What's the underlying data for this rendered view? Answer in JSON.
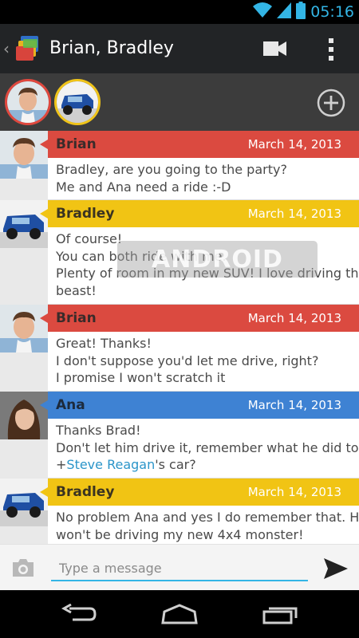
{
  "status_bar": {
    "time": "05:16",
    "icons": [
      "wifi-icon",
      "signal-icon",
      "battery-icon"
    ]
  },
  "action_bar": {
    "title": "Brian, Bradley",
    "icons": [
      "back-caret-icon",
      "app-icon",
      "video-call-icon",
      "overflow-menu-icon"
    ]
  },
  "participants": {
    "avatars": [
      "brian",
      "bradley"
    ],
    "add_icon": "add-circle-icon"
  },
  "colors": {
    "red": "#db4a40",
    "yellow": "#f1c414",
    "blue": "#3e82d3",
    "accent": "#33b5e5",
    "mention": "#2b95c9"
  },
  "messages": [
    {
      "sender": "Brian",
      "date": "March 14, 2013",
      "color": "red",
      "lines": [
        "Bradley, are you going to the party?",
        "Me and Ana need a ride :-D"
      ]
    },
    {
      "sender": "Bradley",
      "date": "March 14, 2013",
      "color": "yellow",
      "lines": [
        "Of course!",
        "You can both ride with me.",
        "Plenty of room in my new SUV! I love driving that",
        "beast!"
      ]
    },
    {
      "sender": "Brian",
      "date": "March 14, 2013",
      "color": "red",
      "lines": [
        "Great! Thanks!",
        "I don't suppose you'd let me drive, right?",
        "I promise I won't scratch it"
      ]
    },
    {
      "sender": "Ana",
      "date": "March 14, 2013",
      "color": "blue",
      "lines": [
        "Thanks Brad!",
        "Don't let him drive it, remember what he did to"
      ],
      "mention_line": {
        "prefix": "+",
        "mention": "Steve Reagan",
        "suffix": "'s car?"
      }
    },
    {
      "sender": "Bradley",
      "date": "March 14, 2013",
      "color": "yellow",
      "lines": [
        "No problem Ana and yes I do remember that. He",
        "won't be driving my new 4x4 monster!"
      ]
    }
  ],
  "watermark": "ANDROID",
  "composer": {
    "placeholder": "Type a message",
    "camera_icon": "camera-icon",
    "send_icon": "send-icon"
  },
  "nav_bar": {
    "icons": [
      "back-icon",
      "home-icon",
      "recent-apps-icon"
    ]
  }
}
